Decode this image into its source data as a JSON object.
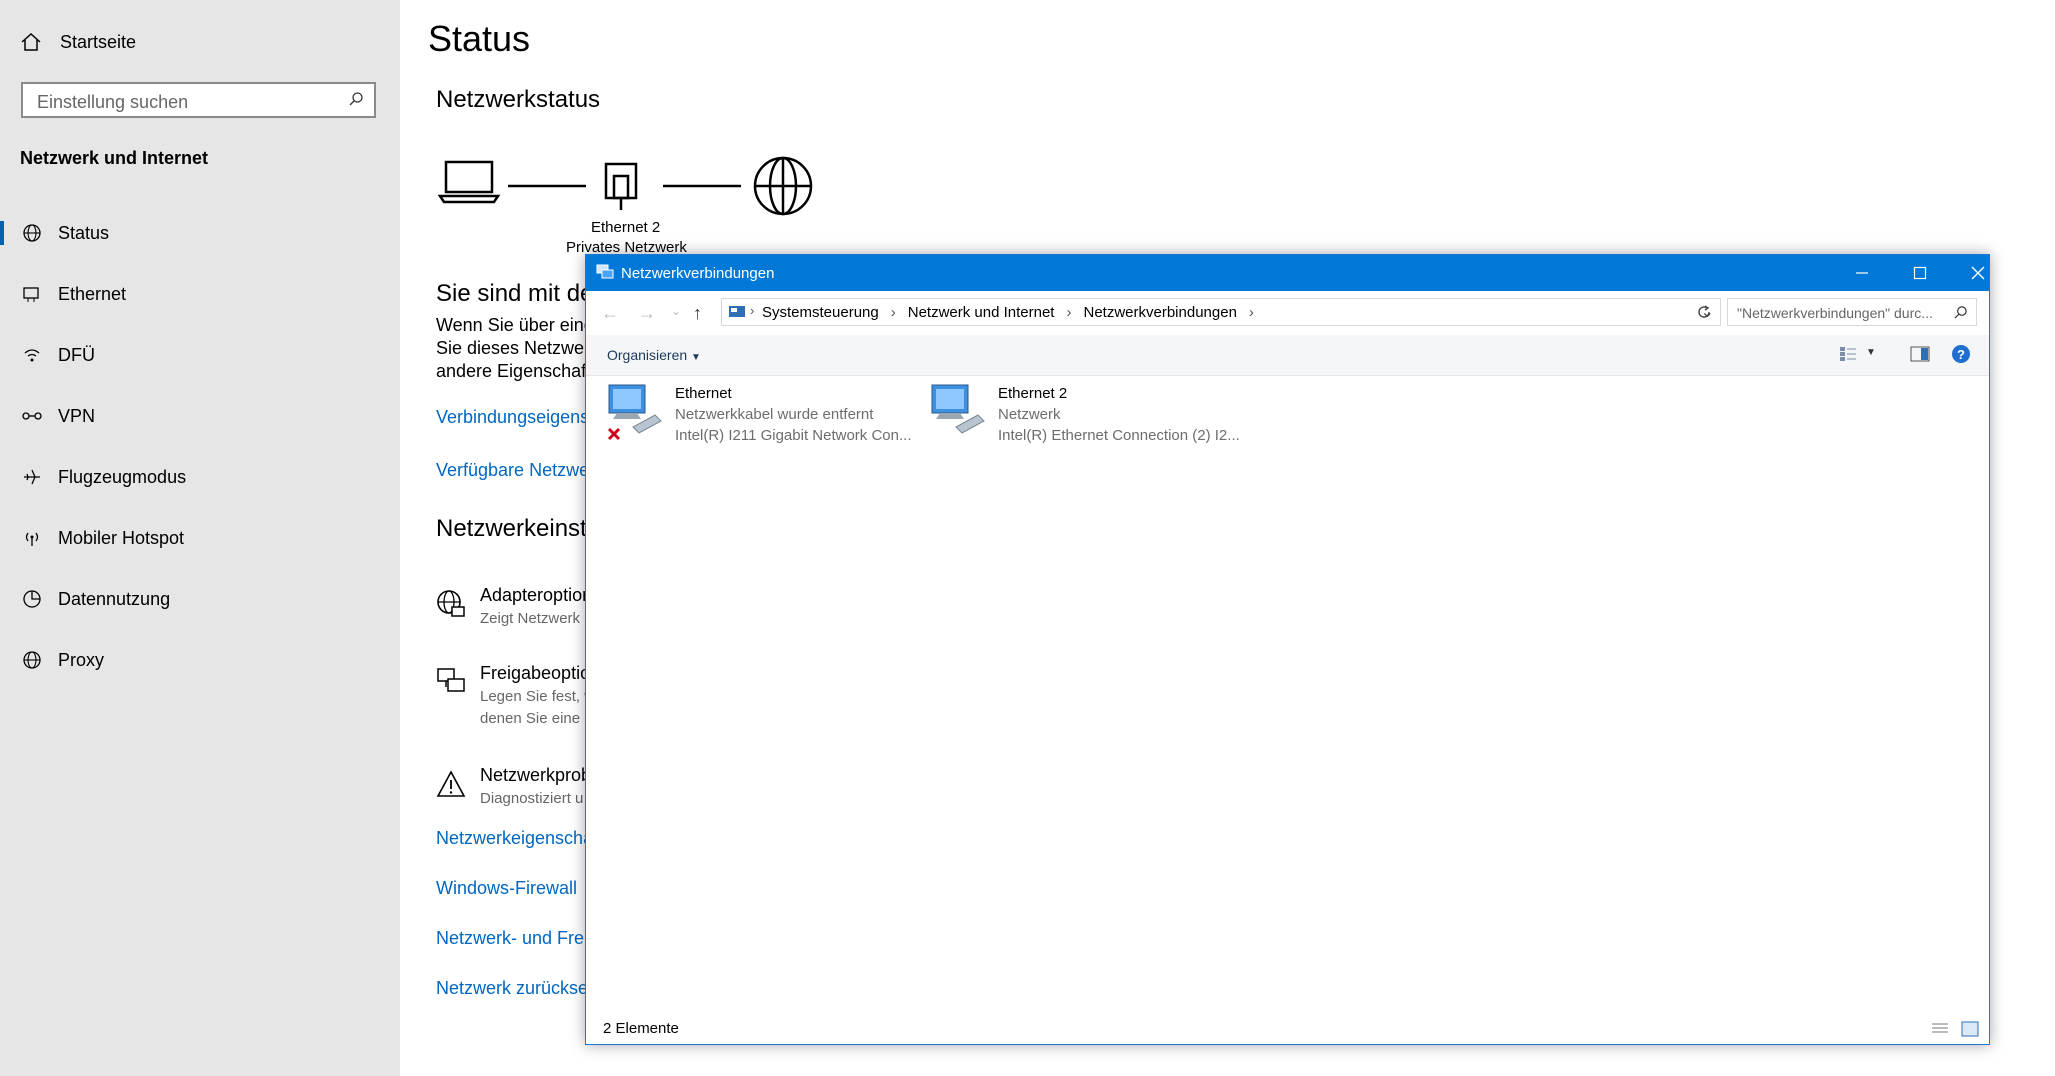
{
  "sidebar": {
    "home_label": "Startseite",
    "search_placeholder": "Einstellung suchen",
    "section_title": "Netzwerk und Internet",
    "items": [
      {
        "label": "Status",
        "icon": "globe-status-icon"
      },
      {
        "label": "Ethernet",
        "icon": "ethernet-icon"
      },
      {
        "label": "DFÜ",
        "icon": "dialup-icon"
      },
      {
        "label": "VPN",
        "icon": "vpn-icon"
      },
      {
        "label": "Flugzeugmodus",
        "icon": "airplane-icon"
      },
      {
        "label": "Mobiler Hotspot",
        "icon": "hotspot-icon"
      },
      {
        "label": "Datennutzung",
        "icon": "data-usage-icon"
      },
      {
        "label": "Proxy",
        "icon": "globe-icon"
      }
    ]
  },
  "main": {
    "title": "Status",
    "network_status_heading": "Netzwerkstatus",
    "diagram_label_1": "Ethernet 2",
    "diagram_label_2": "Privates Netzwerk",
    "connected_heading": "Sie sind mit den",
    "desc_line1": "Wenn Sie über einen",
    "desc_line2": "Sie dieses Netzwerk",
    "desc_line3": "andere Eigenschafte",
    "link_connection_props": "Verbindungseigensc",
    "link_available_networks": "Verfügbare Netzwer",
    "settings_heading": "Netzwerkeinste",
    "options": [
      {
        "title": "Adapteroption",
        "desc1": "Zeigt Netzwerk",
        "desc2": ""
      },
      {
        "title": "Freigabeoption",
        "desc1": "Legen Sie fest, w",
        "desc2": "denen Sie eine"
      },
      {
        "title": "Netzwerkprob",
        "desc1": "Diagnostiziert u",
        "desc2": ""
      }
    ],
    "links": [
      "Netzwerkeigenschaf",
      "Windows-Firewall",
      "Netzwerk- und Freig",
      "Netzwerk zurücksetz"
    ]
  },
  "window": {
    "title": "Netzwerkverbindungen",
    "breadcrumbs": [
      "Systemsteuerung",
      "Netzwerk und Internet",
      "Netzwerkverbindungen"
    ],
    "search_placeholder": "\"Netzwerkverbindungen\" durc...",
    "organize_label": "Organisieren",
    "items": [
      {
        "name": "Ethernet",
        "status": "Netzwerkkabel wurde entfernt",
        "adapter": "Intel(R) I211 Gigabit Network Con...",
        "disconnected": true
      },
      {
        "name": "Ethernet 2",
        "status": "Netzwerk",
        "adapter": "Intel(R) Ethernet Connection (2) I2...",
        "disconnected": false
      }
    ],
    "item_count": "2 Elemente",
    "title_color": "#0078d7"
  },
  "colors": {
    "accent": "#0067c0",
    "sidebar_bg": "#e6e6e6"
  }
}
